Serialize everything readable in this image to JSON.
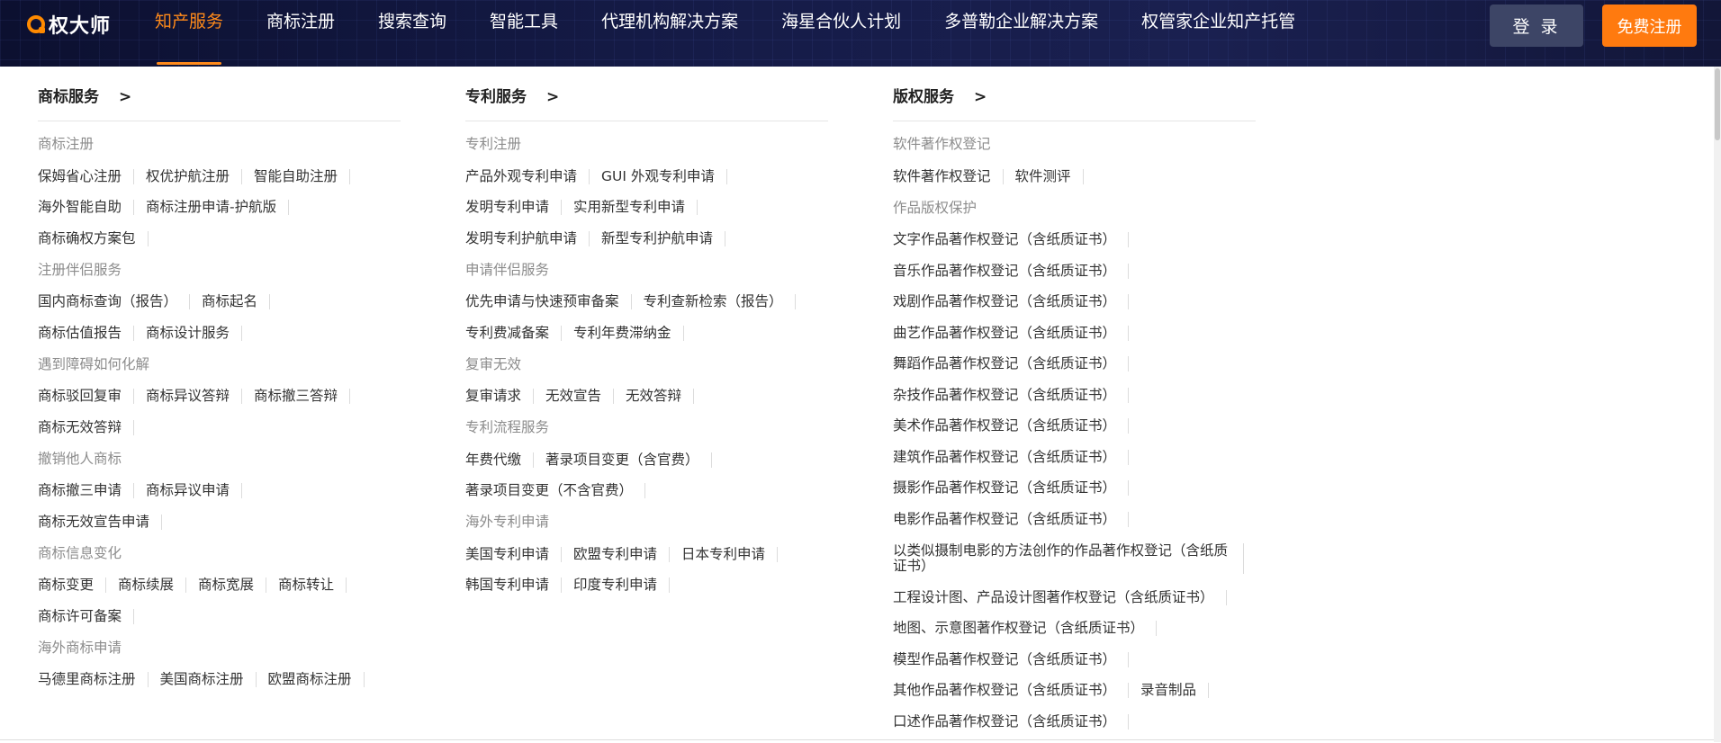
{
  "logo": {
    "text": "权大师"
  },
  "nav": {
    "items": [
      "知产服务",
      "商标注册",
      "搜索查询",
      "智能工具",
      "代理机构解决方案",
      "海星合伙人计划",
      "多普勒企业解决方案",
      "权管家企业知产托管"
    ],
    "login_label": "登 录",
    "register_label": "免费注册"
  },
  "columns": [
    {
      "title": "商标服务",
      "arrow": ">",
      "groups": [
        {
          "title": "商标注册",
          "rows": [
            [
              "保姆省心注册",
              "权优护航注册",
              "智能自助注册"
            ],
            [
              "海外智能自助",
              "商标注册申请-护航版"
            ],
            [
              "商标确权方案包"
            ]
          ]
        },
        {
          "title": "注册伴侣服务",
          "rows": [
            [
              "国内商标查询（报告）",
              "商标起名"
            ],
            [
              "商标估值报告",
              "商标设计服务"
            ]
          ]
        },
        {
          "title": "遇到障碍如何化解",
          "rows": [
            [
              "商标驳回复审",
              "商标异议答辩",
              "商标撤三答辩"
            ],
            [
              "商标无效答辩"
            ]
          ]
        },
        {
          "title": "撤销他人商标",
          "rows": [
            [
              "商标撤三申请",
              "商标异议申请"
            ],
            [
              "商标无效宣告申请"
            ]
          ]
        },
        {
          "title": "商标信息变化",
          "rows": [
            [
              "商标变更",
              "商标续展",
              "商标宽展",
              "商标转让"
            ],
            [
              "商标许可备案"
            ]
          ]
        },
        {
          "title": "海外商标申请",
          "rows": [
            [
              "马德里商标注册",
              "美国商标注册",
              "欧盟商标注册"
            ]
          ]
        }
      ]
    },
    {
      "title": "专利服务",
      "arrow": ">",
      "groups": [
        {
          "title": "专利注册",
          "rows": [
            [
              "产品外观专利申请",
              "GUI 外观专利申请"
            ],
            [
              "发明专利申请",
              "实用新型专利申请"
            ],
            [
              "发明专利护航申请",
              "新型专利护航申请"
            ]
          ]
        },
        {
          "title": "申请伴侣服务",
          "rows": [
            [
              "优先申请与快速预审备案",
              "专利查新检索（报告）"
            ],
            [
              "专利费减备案",
              "专利年费滞纳金"
            ]
          ]
        },
        {
          "title": "复审无效",
          "rows": [
            [
              "复审请求",
              "无效宣告",
              "无效答辩"
            ]
          ]
        },
        {
          "title": "专利流程服务",
          "rows": [
            [
              "年费代缴",
              "著录项目变更（含官费）"
            ],
            [
              "著录项目变更（不含官费）"
            ]
          ]
        },
        {
          "title": "海外专利申请",
          "rows": [
            [
              "美国专利申请",
              "欧盟专利申请",
              "日本专利申请"
            ],
            [
              "韩国专利申请",
              "印度专利申请"
            ]
          ]
        }
      ]
    },
    {
      "title": "版权服务",
      "arrow": ">",
      "groups": [
        {
          "title": "软件著作权登记",
          "rows": [
            [
              "软件著作权登记",
              "软件测评"
            ]
          ]
        },
        {
          "title": "作品版权保护",
          "rows": [
            [
              "文字作品著作权登记（含纸质证书）"
            ],
            [
              "音乐作品著作权登记（含纸质证书）"
            ],
            [
              "戏剧作品著作权登记（含纸质证书）"
            ],
            [
              "曲艺作品著作权登记（含纸质证书）"
            ],
            [
              "舞蹈作品著作权登记（含纸质证书）"
            ],
            [
              "杂技作品著作权登记（含纸质证书）"
            ],
            [
              "美术作品著作权登记（含纸质证书）"
            ],
            [
              "建筑作品著作权登记（含纸质证书）"
            ],
            [
              "摄影作品著作权登记（含纸质证书）"
            ],
            [
              "电影作品著作权登记（含纸质证书）"
            ],
            [
              "以类似摄制电影的方法创作的作品著作权登记（含纸质证书）"
            ],
            [
              "工程设计图、产品设计图著作权登记（含纸质证书）"
            ],
            [
              "地图、示意图著作权登记（含纸质证书）"
            ],
            [
              "模型作品著作权登记（含纸质证书）"
            ],
            [
              "其他作品著作权登记（含纸质证书）",
              "录音制品"
            ],
            [
              "口述作品著作权登记（含纸质证书）"
            ]
          ]
        }
      ]
    }
  ]
}
